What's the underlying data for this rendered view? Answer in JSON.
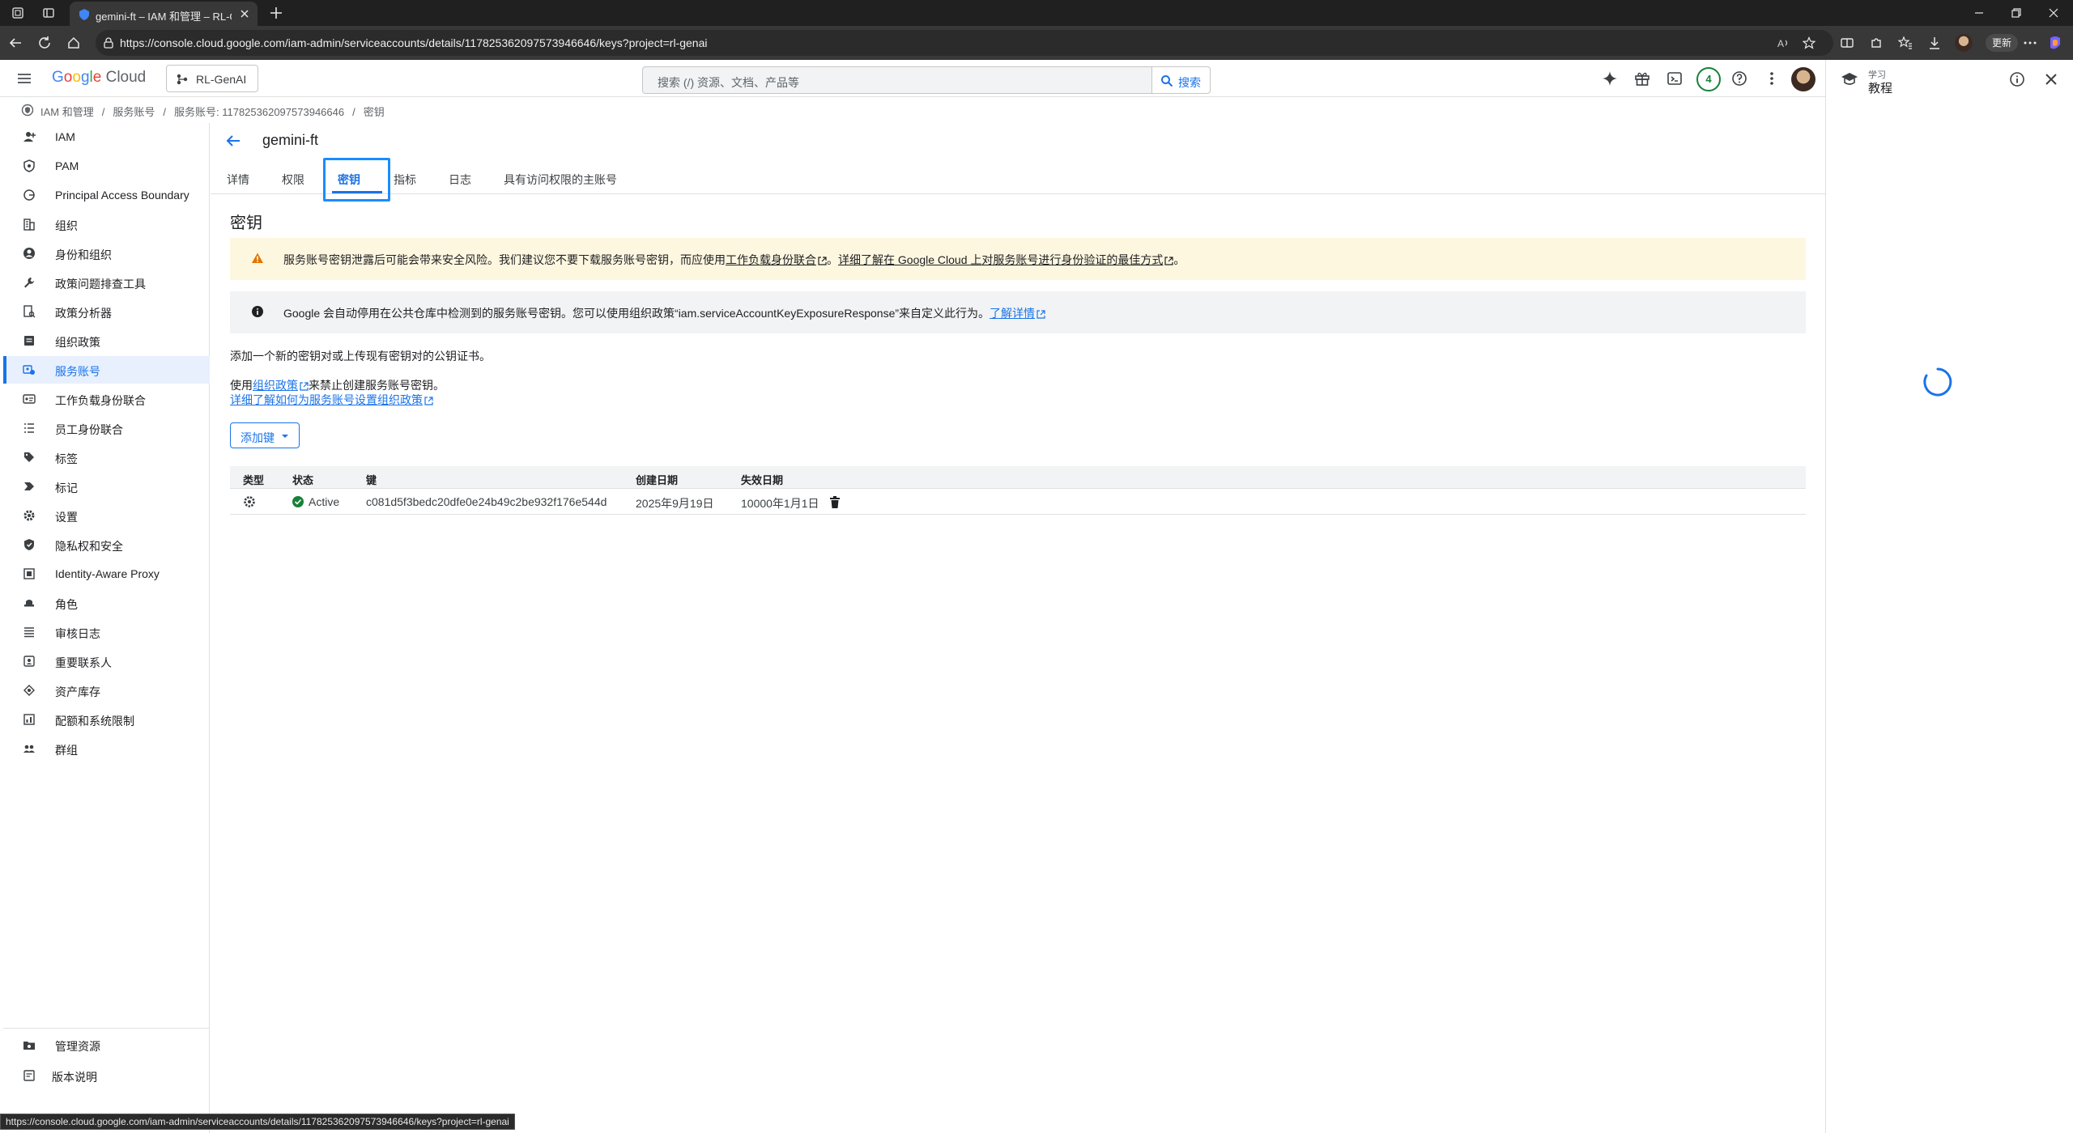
{
  "browser": {
    "tab_title": "gemini-ft – IAM 和管理 – RL-GenAI",
    "url": "https://console.cloud.google.com/iam-admin/serviceaccounts/details/117825362097573946646/keys?project=rl-genai",
    "update_label": "更新"
  },
  "header": {
    "logo_parts": [
      "G",
      "o",
      "o",
      "g",
      "l",
      "e"
    ],
    "logo_cloud": "Cloud",
    "project": "RL-GenAI",
    "search_placeholder": "搜索 (/) 资源、文档、产品等",
    "search_button": "搜索",
    "notification_count": "4"
  },
  "breadcrumb": {
    "items": [
      "IAM 和管理",
      "服务账号",
      "服务账号: 117825362097573946646",
      "密钥"
    ]
  },
  "sidebar": {
    "items": [
      {
        "label": "IAM",
        "icon": "add-person-icon"
      },
      {
        "label": "PAM",
        "icon": "shield-icon"
      },
      {
        "label": "Principal Access Boundary",
        "icon": "boundary-icon"
      },
      {
        "label": "组织",
        "icon": "building-icon"
      },
      {
        "label": "身份和组织",
        "icon": "account-circle-icon"
      },
      {
        "label": "政策问题排查工具",
        "icon": "wrench-icon"
      },
      {
        "label": "政策分析器",
        "icon": "policy-search-icon"
      },
      {
        "label": "组织政策",
        "icon": "list-box-icon"
      },
      {
        "label": "服务账号",
        "icon": "service-account-icon"
      },
      {
        "label": "工作负载身份联合",
        "icon": "id-card-icon"
      },
      {
        "label": "员工身份联合",
        "icon": "list-icon"
      },
      {
        "label": "标签",
        "icon": "tag-icon"
      },
      {
        "label": "标记",
        "icon": "label-icon"
      },
      {
        "label": "设置",
        "icon": "gear-icon"
      },
      {
        "label": "隐私权和安全",
        "icon": "privacy-shield-icon"
      },
      {
        "label": "Identity-Aware Proxy",
        "icon": "proxy-icon"
      },
      {
        "label": "角色",
        "icon": "hat-icon"
      },
      {
        "label": "审核日志",
        "icon": "lines-icon"
      },
      {
        "label": "重要联系人",
        "icon": "contact-icon"
      },
      {
        "label": "资产库存",
        "icon": "diamond-icon"
      },
      {
        "label": "配额和系统限制",
        "icon": "chart-box-icon"
      },
      {
        "label": "群组",
        "icon": "group-icon"
      }
    ],
    "bottom": [
      {
        "label": "管理资源",
        "icon": "folder-gear-icon"
      },
      {
        "label": "版本说明",
        "icon": "notes-icon"
      }
    ]
  },
  "main": {
    "account_name": "gemini-ft",
    "tabs": [
      "详情",
      "权限",
      "密钥",
      "指标",
      "日志",
      "具有访问权限的主账号"
    ],
    "section_title": "密钥",
    "warning": {
      "text1": "服务账号密钥泄露后可能会带来安全风险。我们建议您不要下载服务账号密钥，而应使用",
      "link1": "工作负载身份联合",
      "text2": "。",
      "link2": "详细了解在 Google Cloud 上对服务账号进行身份验证的最佳方式",
      "text3": "。"
    },
    "info": {
      "text": "Google 会自动停用在公共仓库中检测到的服务账号密钥。您可以使用组织政策“iam.serviceAccountKeyExposureResponse”来自定义此行为。",
      "link": "了解详情"
    },
    "para1": "添加一个新的密钥对或上传现有密钥对的公钥证书。",
    "para2_prefix": "使用",
    "para2_link": "组织政策",
    "para2_suffix": "来禁止创建服务账号密钥。",
    "para3_link": "详细了解如何为服务账号设置组织政策",
    "add_key": "添加键",
    "table": {
      "headers": [
        "类型",
        "状态",
        "键",
        "创建日期",
        "失效日期"
      ],
      "rows": [
        {
          "status": "Active",
          "key": "c081d5f3bedc20dfe0e24b49c2be932f176e544d",
          "created": "2025年9月19日",
          "expires": "10000年1月1日"
        }
      ]
    }
  },
  "right_panel": {
    "subtitle": "学习",
    "title": "教程"
  },
  "status_url": "https://console.cloud.google.com/iam-admin/serviceaccounts/details/117825362097573946646/keys?project=rl-genai",
  "colors": {
    "accent": "#1a73e8",
    "warning_bg": "#fef7e0",
    "active_green": "#188038"
  }
}
